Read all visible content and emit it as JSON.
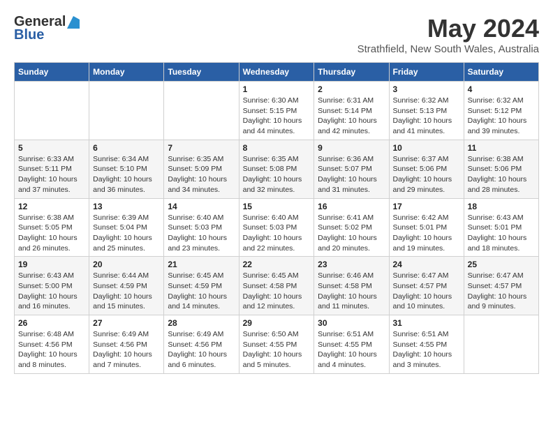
{
  "header": {
    "logo_general": "General",
    "logo_blue": "Blue",
    "title": "May 2024",
    "location": "Strathfield, New South Wales, Australia"
  },
  "weekdays": [
    "Sunday",
    "Monday",
    "Tuesday",
    "Wednesday",
    "Thursday",
    "Friday",
    "Saturday"
  ],
  "weeks": [
    [
      {
        "day": "",
        "info": ""
      },
      {
        "day": "",
        "info": ""
      },
      {
        "day": "",
        "info": ""
      },
      {
        "day": "1",
        "info": "Sunrise: 6:30 AM\nSunset: 5:15 PM\nDaylight: 10 hours\nand 44 minutes."
      },
      {
        "day": "2",
        "info": "Sunrise: 6:31 AM\nSunset: 5:14 PM\nDaylight: 10 hours\nand 42 minutes."
      },
      {
        "day": "3",
        "info": "Sunrise: 6:32 AM\nSunset: 5:13 PM\nDaylight: 10 hours\nand 41 minutes."
      },
      {
        "day": "4",
        "info": "Sunrise: 6:32 AM\nSunset: 5:12 PM\nDaylight: 10 hours\nand 39 minutes."
      }
    ],
    [
      {
        "day": "5",
        "info": "Sunrise: 6:33 AM\nSunset: 5:11 PM\nDaylight: 10 hours\nand 37 minutes."
      },
      {
        "day": "6",
        "info": "Sunrise: 6:34 AM\nSunset: 5:10 PM\nDaylight: 10 hours\nand 36 minutes."
      },
      {
        "day": "7",
        "info": "Sunrise: 6:35 AM\nSunset: 5:09 PM\nDaylight: 10 hours\nand 34 minutes."
      },
      {
        "day": "8",
        "info": "Sunrise: 6:35 AM\nSunset: 5:08 PM\nDaylight: 10 hours\nand 32 minutes."
      },
      {
        "day": "9",
        "info": "Sunrise: 6:36 AM\nSunset: 5:07 PM\nDaylight: 10 hours\nand 31 minutes."
      },
      {
        "day": "10",
        "info": "Sunrise: 6:37 AM\nSunset: 5:06 PM\nDaylight: 10 hours\nand 29 minutes."
      },
      {
        "day": "11",
        "info": "Sunrise: 6:38 AM\nSunset: 5:06 PM\nDaylight: 10 hours\nand 28 minutes."
      }
    ],
    [
      {
        "day": "12",
        "info": "Sunrise: 6:38 AM\nSunset: 5:05 PM\nDaylight: 10 hours\nand 26 minutes."
      },
      {
        "day": "13",
        "info": "Sunrise: 6:39 AM\nSunset: 5:04 PM\nDaylight: 10 hours\nand 25 minutes."
      },
      {
        "day": "14",
        "info": "Sunrise: 6:40 AM\nSunset: 5:03 PM\nDaylight: 10 hours\nand 23 minutes."
      },
      {
        "day": "15",
        "info": "Sunrise: 6:40 AM\nSunset: 5:03 PM\nDaylight: 10 hours\nand 22 minutes."
      },
      {
        "day": "16",
        "info": "Sunrise: 6:41 AM\nSunset: 5:02 PM\nDaylight: 10 hours\nand 20 minutes."
      },
      {
        "day": "17",
        "info": "Sunrise: 6:42 AM\nSunset: 5:01 PM\nDaylight: 10 hours\nand 19 minutes."
      },
      {
        "day": "18",
        "info": "Sunrise: 6:43 AM\nSunset: 5:01 PM\nDaylight: 10 hours\nand 18 minutes."
      }
    ],
    [
      {
        "day": "19",
        "info": "Sunrise: 6:43 AM\nSunset: 5:00 PM\nDaylight: 10 hours\nand 16 minutes."
      },
      {
        "day": "20",
        "info": "Sunrise: 6:44 AM\nSunset: 4:59 PM\nDaylight: 10 hours\nand 15 minutes."
      },
      {
        "day": "21",
        "info": "Sunrise: 6:45 AM\nSunset: 4:59 PM\nDaylight: 10 hours\nand 14 minutes."
      },
      {
        "day": "22",
        "info": "Sunrise: 6:45 AM\nSunset: 4:58 PM\nDaylight: 10 hours\nand 12 minutes."
      },
      {
        "day": "23",
        "info": "Sunrise: 6:46 AM\nSunset: 4:58 PM\nDaylight: 10 hours\nand 11 minutes."
      },
      {
        "day": "24",
        "info": "Sunrise: 6:47 AM\nSunset: 4:57 PM\nDaylight: 10 hours\nand 10 minutes."
      },
      {
        "day": "25",
        "info": "Sunrise: 6:47 AM\nSunset: 4:57 PM\nDaylight: 10 hours\nand 9 minutes."
      }
    ],
    [
      {
        "day": "26",
        "info": "Sunrise: 6:48 AM\nSunset: 4:56 PM\nDaylight: 10 hours\nand 8 minutes."
      },
      {
        "day": "27",
        "info": "Sunrise: 6:49 AM\nSunset: 4:56 PM\nDaylight: 10 hours\nand 7 minutes."
      },
      {
        "day": "28",
        "info": "Sunrise: 6:49 AM\nSunset: 4:56 PM\nDaylight: 10 hours\nand 6 minutes."
      },
      {
        "day": "29",
        "info": "Sunrise: 6:50 AM\nSunset: 4:55 PM\nDaylight: 10 hours\nand 5 minutes."
      },
      {
        "day": "30",
        "info": "Sunrise: 6:51 AM\nSunset: 4:55 PM\nDaylight: 10 hours\nand 4 minutes."
      },
      {
        "day": "31",
        "info": "Sunrise: 6:51 AM\nSunset: 4:55 PM\nDaylight: 10 hours\nand 3 minutes."
      },
      {
        "day": "",
        "info": ""
      }
    ]
  ]
}
